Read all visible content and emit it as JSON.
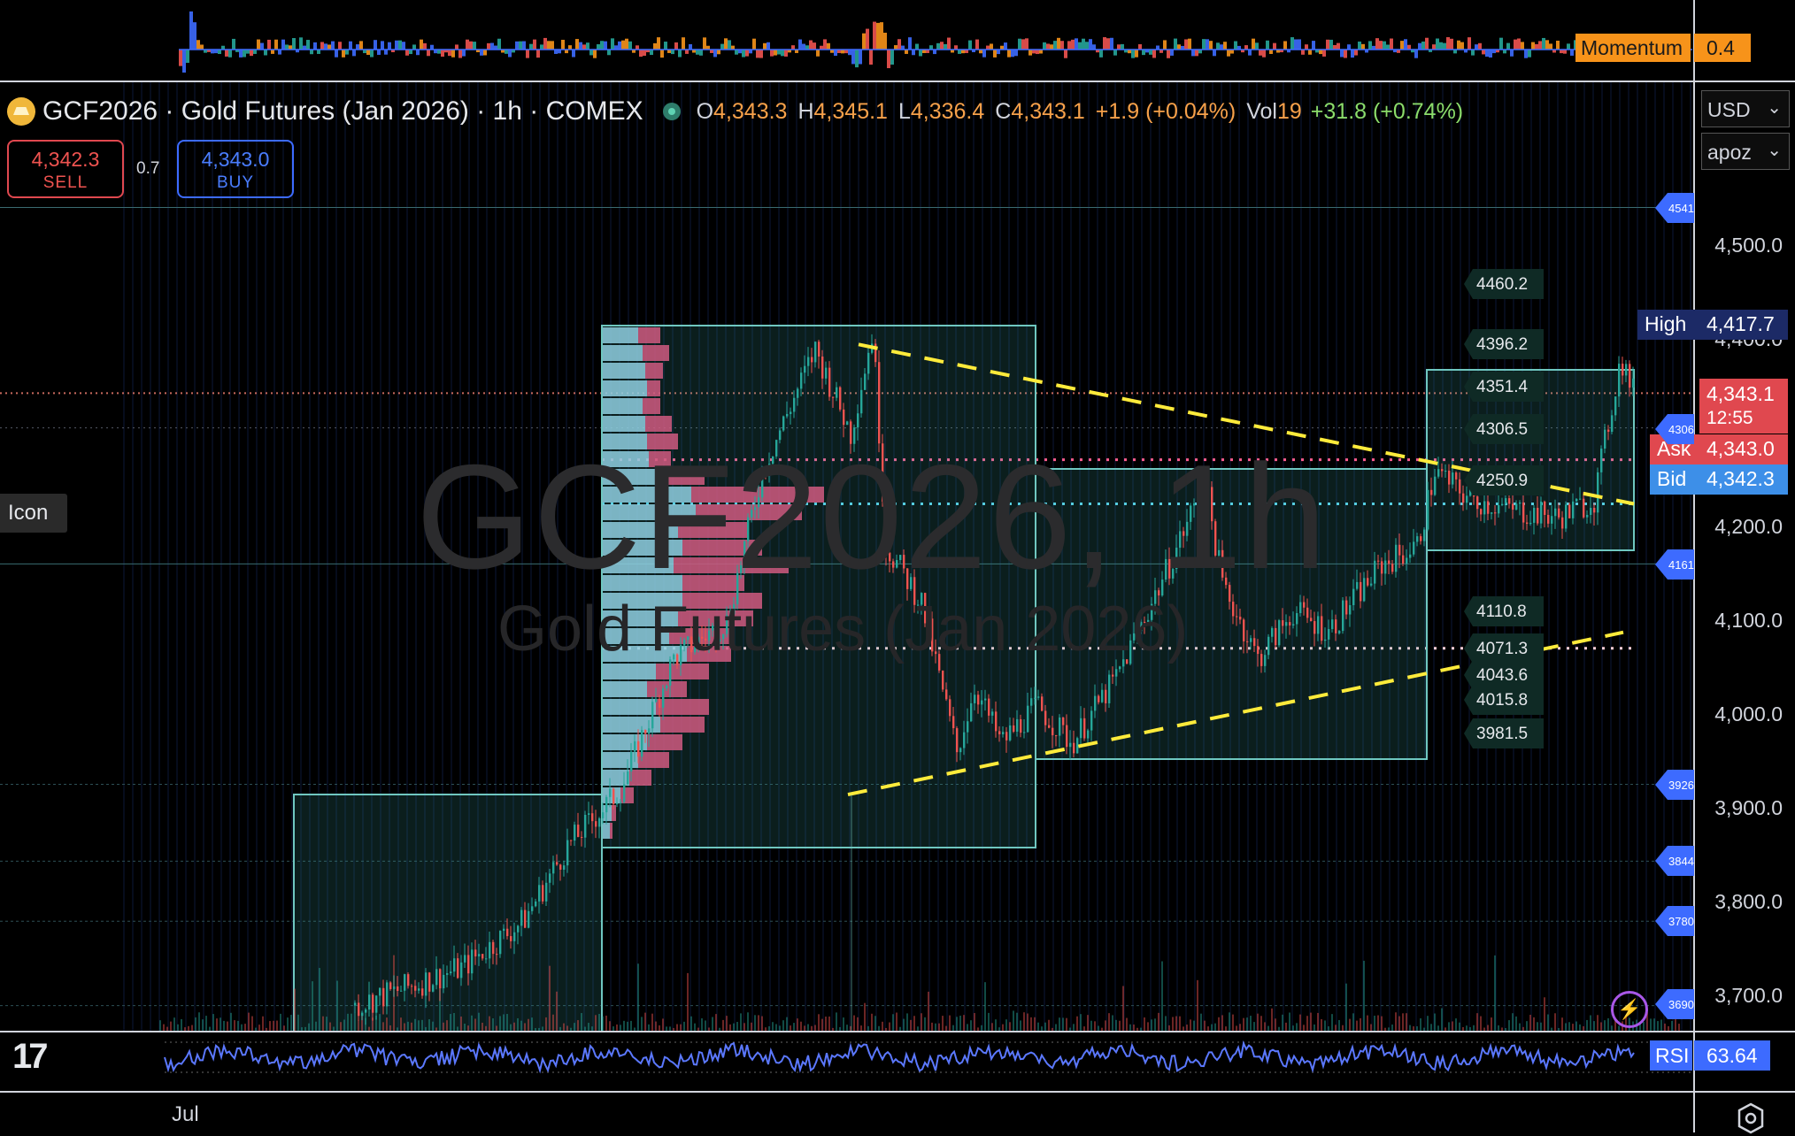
{
  "header": {
    "symbol": "GCF2026 · Gold Futures (Jan 2026) · 1h · COMEX",
    "open_label": "O",
    "open": "4,343.3",
    "high_label": "H",
    "high": "4,345.1",
    "low_label": "L",
    "low": "4,336.4",
    "close_label": "C",
    "close": "4,343.1",
    "change": "+1.9 (+0.04%)",
    "vol_label": "Vol",
    "vol": "19",
    "vol_change": "+31.8 (+0.74%)"
  },
  "trade": {
    "sell_price": "4,342.3",
    "sell_label": "SELL",
    "spread": "0.7",
    "buy_price": "4,343.0",
    "buy_label": "BUY"
  },
  "selectors": {
    "currency": "USD",
    "unit": "apoz"
  },
  "momentum": {
    "label": "Momentum",
    "value": "0.4"
  },
  "price_axis": [
    {
      "label": "4,500.0"
    },
    {
      "label": "4,400.0"
    },
    {
      "label": "4,200.0"
    },
    {
      "label": "4,100.0"
    },
    {
      "label": "4,000.0"
    },
    {
      "label": "3,900.0"
    },
    {
      "label": "3,800.0"
    },
    {
      "label": "3,700.0"
    }
  ],
  "price_tags": {
    "high_label": "High",
    "high_value": "4,417.7",
    "last_price": "4,343.1",
    "countdown": "12:55",
    "ask_label": "Ask",
    "ask_value": "4,343.0",
    "bid_label": "Bid",
    "bid_value": "4,342.3"
  },
  "alert_tabs": [
    "4541",
    "4306",
    "4161",
    "3926",
    "3844",
    "3780",
    "3690"
  ],
  "box_labels": [
    "4460.2",
    "4396.2",
    "4351.4",
    "4306.5",
    "4250.9",
    "4110.8",
    "4071.3",
    "4043.6",
    "4015.8",
    "3981.5"
  ],
  "watermark": {
    "line1": "GCF2026, 1h",
    "line2": "Gold Futures (Jan 2026)"
  },
  "tooltip": "Icon",
  "time_axis": {
    "label": "Jul"
  },
  "rsi": {
    "label": "RSI",
    "value": "63.64"
  },
  "colors": {
    "background": "#000000",
    "up": "#26a69a",
    "down": "#ef5350",
    "accent": "#3d6bff",
    "momentum": "#f7931a",
    "trend": "#ffeb3b"
  },
  "icons": [
    "gold-logo-icon",
    "market-status-icon",
    "chevron-down-icon",
    "tradingview-logo-icon",
    "settings-icon",
    "lightning-icon"
  ]
}
